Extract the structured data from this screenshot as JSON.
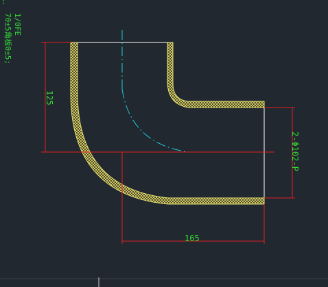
{
  "colors": {
    "background": "#212830",
    "dimension": "#e02020",
    "centerline": "#20c8d8",
    "outline": "#ffffff",
    "pipe_wall": "#e8e070",
    "text": "#33dd33"
  },
  "notes": {
    "line1": ":",
    "line2": "70±5角板0±5;",
    "line3": "1/0FE"
  },
  "dimensions": {
    "height_label": "125",
    "width_label": "165",
    "diameter_label": "2-Φ102-P"
  }
}
